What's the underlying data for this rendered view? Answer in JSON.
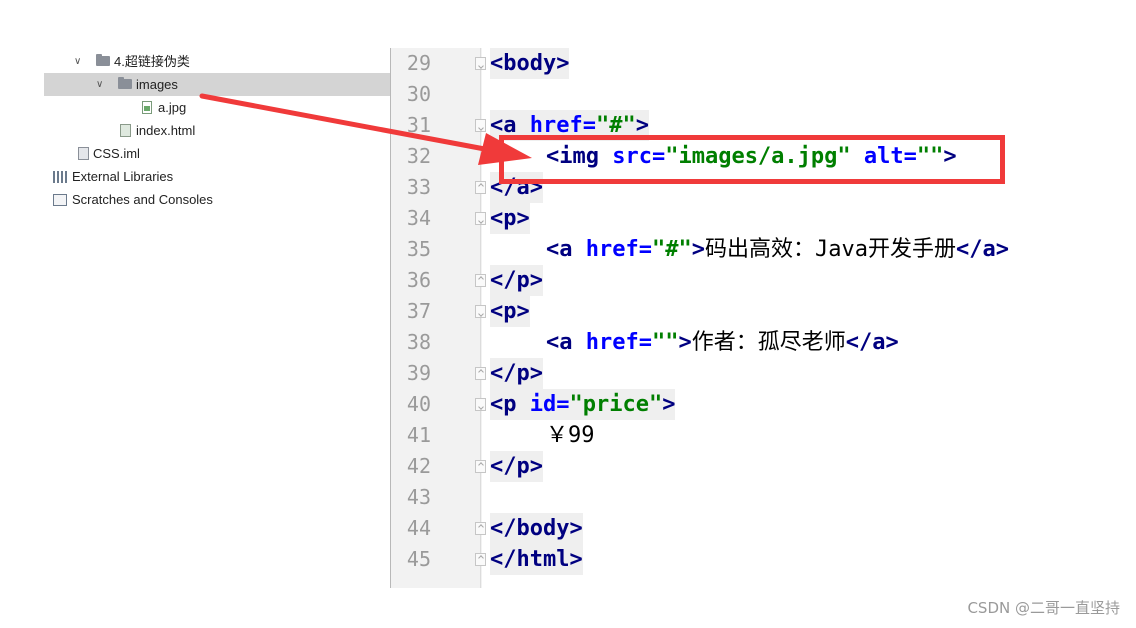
{
  "project_tree": {
    "items": [
      {
        "label": "4.超链接伪类",
        "icon": "folder-icon",
        "chevron": "expanded"
      },
      {
        "label": "images",
        "icon": "folder-icon",
        "chevron": "expanded",
        "selected": true
      },
      {
        "label": "a.jpg",
        "icon": "image-file-icon"
      },
      {
        "label": "index.html",
        "icon": "html-file-icon"
      },
      {
        "label": "CSS.iml",
        "icon": "iml-file-icon"
      },
      {
        "label": "External Libraries",
        "icon": "libraries-icon"
      },
      {
        "label": "Scratches and Consoles",
        "icon": "scratches-icon"
      }
    ]
  },
  "editor": {
    "line_numbers": [
      "29",
      "30",
      "31",
      "32",
      "33",
      "34",
      "35",
      "36",
      "37",
      "38",
      "39",
      "40",
      "41",
      "42",
      "43",
      "44",
      "45"
    ],
    "lines": {
      "l29": {
        "tag_open": "<body>"
      },
      "l31": {
        "lt": "<a ",
        "attr": "href=",
        "val": "\"#\"",
        "gt": ">"
      },
      "l32": {
        "lt": "<img ",
        "attr1": "src=",
        "val1": "\"images/a.jpg\"",
        "sp": " ",
        "attr2": "alt=",
        "val2": "\"\"",
        "gt": ">"
      },
      "l33": {
        "tag": "</a>"
      },
      "l34": {
        "tag": "<p>"
      },
      "l35": {
        "lt": "<a ",
        "attr": "href=",
        "val": "\"#\"",
        "gt": ">",
        "text": "码出高效：Java开发手册",
        "close": "</a>"
      },
      "l36": {
        "tag": "</p>"
      },
      "l37": {
        "tag": "<p>"
      },
      "l38": {
        "lt": "<a ",
        "attr": "href=",
        "val": "\"\"",
        "gt": ">",
        "text": "作者：孤尽老师",
        "close": "</a>"
      },
      "l39": {
        "tag": "</p>"
      },
      "l40": {
        "lt": "<p ",
        "attr": "id=",
        "val": "\"price\"",
        "gt": ">"
      },
      "l41": {
        "text": "￥99"
      },
      "l42": {
        "tag": "</p>"
      },
      "l44": {
        "tag": "</body>"
      },
      "l45": {
        "tag": "</html>"
      }
    }
  },
  "annotation": {
    "box_color": "#f03a3a",
    "arrow_color": "#f03a3a"
  },
  "watermark": "CSDN @二哥一直坚持"
}
